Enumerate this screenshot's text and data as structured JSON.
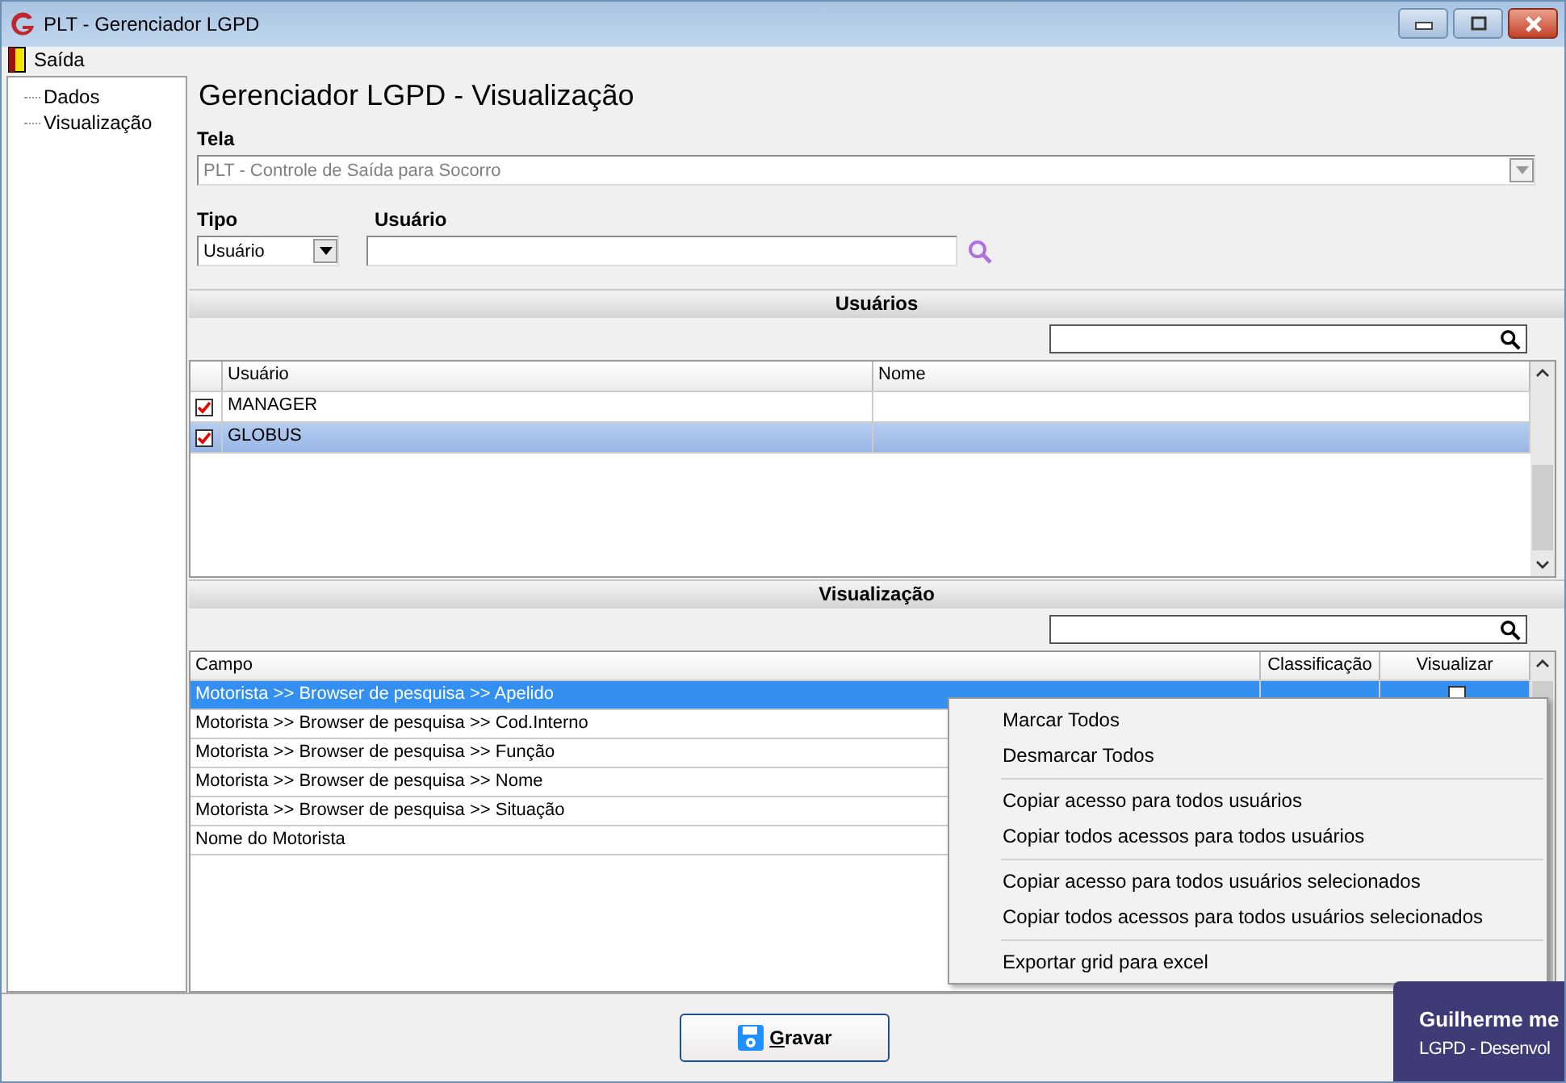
{
  "window": {
    "title": "PLT - Gerenciador LGPD"
  },
  "menu": [
    {
      "label": "Saída"
    }
  ],
  "tree": {
    "items": [
      {
        "label": "Dados"
      },
      {
        "label": "Visualização"
      }
    ]
  },
  "heading": "Gerenciador LGPD - Visualização",
  "tela": {
    "label": "Tela",
    "value": "PLT - Controle de Saída para Socorro",
    "disabled": true
  },
  "tipo": {
    "label": "Tipo",
    "value": "Usuário"
  },
  "usuario": {
    "label": "Usuário"
  },
  "usuarios": {
    "title": "Usuários",
    "columns": [
      "Usuário",
      "Nome"
    ],
    "rows": [
      {
        "usuario": "MANAGER",
        "checked": true,
        "selected": false
      },
      {
        "usuario": "GLOBUS",
        "checked": true,
        "selected": true
      }
    ]
  },
  "visualizacao": {
    "title": "Visualização",
    "columns": [
      "Campo",
      "Classificação",
      "Visualizar"
    ],
    "rows": [
      {
        "campo": "Motorista >> Browser de pesquisa >> Apelido",
        "visualizar": false,
        "selected": true
      },
      {
        "campo": "Motorista >> Browser de pesquisa >> Cod.Interno",
        "selected": false
      },
      {
        "campo": "Motorista >> Browser de pesquisa >> Função",
        "selected": false
      },
      {
        "campo": "Motorista >> Browser de pesquisa >> Nome",
        "selected": false
      },
      {
        "campo": "Motorista >> Browser de pesquisa >> Situação",
        "selected": false
      },
      {
        "campo": "Nome do Motorista",
        "selected": false
      }
    ]
  },
  "context_menu": {
    "groups": [
      {
        "items": [
          "Marcar Todos",
          "Desmarcar Todos"
        ]
      },
      {
        "items": [
          "Copiar acesso para todos usuários",
          "Copiar todos acessos para todos usuários"
        ]
      },
      {
        "items": [
          "Copiar acesso para todos usuários selecionados",
          "Copiar todos acessos para todos usuários selecionados"
        ]
      },
      {
        "items": [
          "Exportar grid para excel"
        ]
      }
    ]
  },
  "save_button": {
    "label": "Gravar"
  },
  "notification": {
    "title": "Guilherme me",
    "text": "LGPD - Desenvol"
  }
}
